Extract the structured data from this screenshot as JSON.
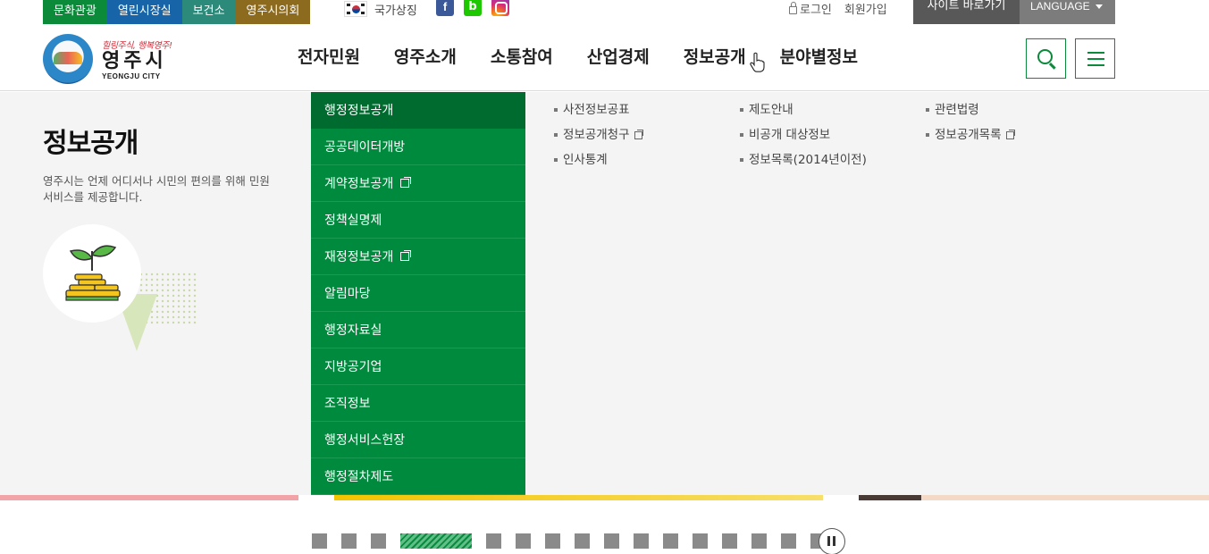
{
  "topbar": {
    "quick_links": [
      {
        "label": "문화관광",
        "color": "#0b8a3a"
      },
      {
        "label": "열린시장실",
        "color": "#1765a8"
      },
      {
        "label": "보건소",
        "color": "#2c8a7a"
      },
      {
        "label": "영주시의회",
        "color": "#8c6a1e"
      }
    ],
    "national_symbol": "국가상징",
    "social": {
      "facebook": "f",
      "blog": "b"
    },
    "login": "로그인",
    "signup": "회원가입",
    "site_shortcut": "사이트 바로가기",
    "language": "LANGUAGE"
  },
  "header": {
    "logo": {
      "slogan": "힐링주식, 행복영주!",
      "name": "영주시",
      "en": "YEONGJU CITY"
    },
    "gnb": [
      "전자민원",
      "영주소개",
      "소통참여",
      "산업경제",
      "정보공개",
      "분야별정보"
    ],
    "accent_color": "#0a8a3a"
  },
  "mega": {
    "title": "정보공개",
    "description": "영주시는 언제 어디서나 시민의 편의를 위해 민원서비스를 제공합니다.",
    "submenu": [
      {
        "label": "행정정보공개",
        "active": true,
        "external": false
      },
      {
        "label": "공공데이터개방",
        "active": false,
        "external": false
      },
      {
        "label": "계약정보공개",
        "active": false,
        "external": true
      },
      {
        "label": "정책실명제",
        "active": false,
        "external": false
      },
      {
        "label": "재정정보공개",
        "active": false,
        "external": true
      },
      {
        "label": "알림마당",
        "active": false,
        "external": false
      },
      {
        "label": "행정자료실",
        "active": false,
        "external": false
      },
      {
        "label": "지방공기업",
        "active": false,
        "external": false
      },
      {
        "label": "조직정보",
        "active": false,
        "external": false
      },
      {
        "label": "행정서비스헌장",
        "active": false,
        "external": false
      },
      {
        "label": "행정절차제도",
        "active": false,
        "external": false
      }
    ],
    "links": [
      {
        "label": "사전정보공표",
        "external": false
      },
      {
        "label": "제도안내",
        "external": false
      },
      {
        "label": "관련법령",
        "external": false
      },
      {
        "label": "정보공개청구",
        "external": true
      },
      {
        "label": "비공개 대상정보",
        "external": false
      },
      {
        "label": "정보공개목록",
        "external": true
      },
      {
        "label": "인사통계",
        "external": false
      },
      {
        "label": "정보목록(2014년이전)",
        "external": false
      }
    ],
    "panel_color": "#008a3e"
  },
  "slider": {
    "total": 17,
    "active_index": 3,
    "pause_label": "일시정지"
  }
}
